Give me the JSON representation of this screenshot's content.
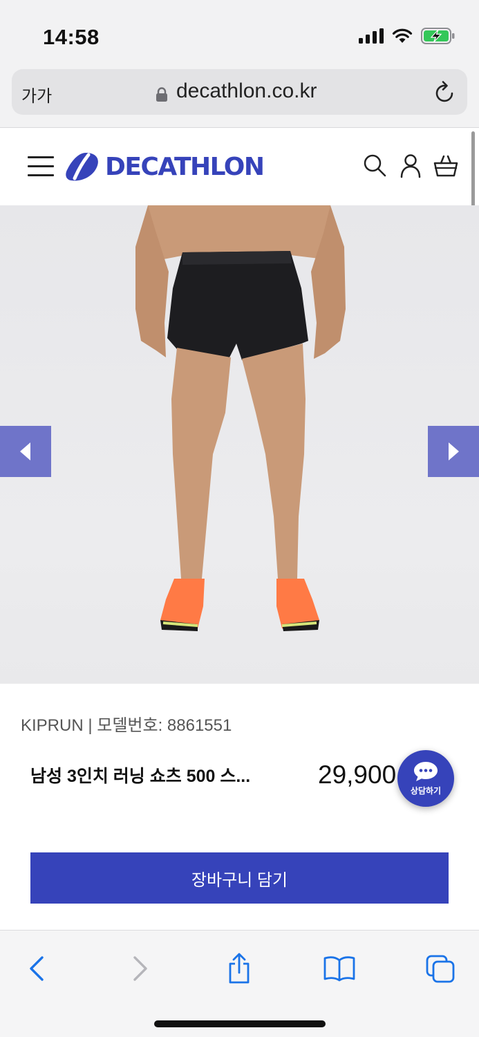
{
  "status": {
    "time": "14:58"
  },
  "browser": {
    "text_size_label": "가가",
    "url": "decathlon.co.kr"
  },
  "site": {
    "logo_text": "DECATHLON",
    "brand_color": "#3643ba"
  },
  "product": {
    "brand_line": "KIPRUN | 모델번호: 8861551",
    "name": "남성 3인치 러닝 쇼츠 500 스...",
    "price": "29,900",
    "add_to_cart_label": "장바구니 담기"
  },
  "chat": {
    "label": "상담하기"
  },
  "icons": {
    "header": [
      "menu-icon",
      "search-icon",
      "user-icon",
      "basket-icon"
    ],
    "toolbar": [
      "back-icon",
      "forward-icon",
      "share-icon",
      "bookmarks-icon",
      "tabs-icon"
    ]
  }
}
